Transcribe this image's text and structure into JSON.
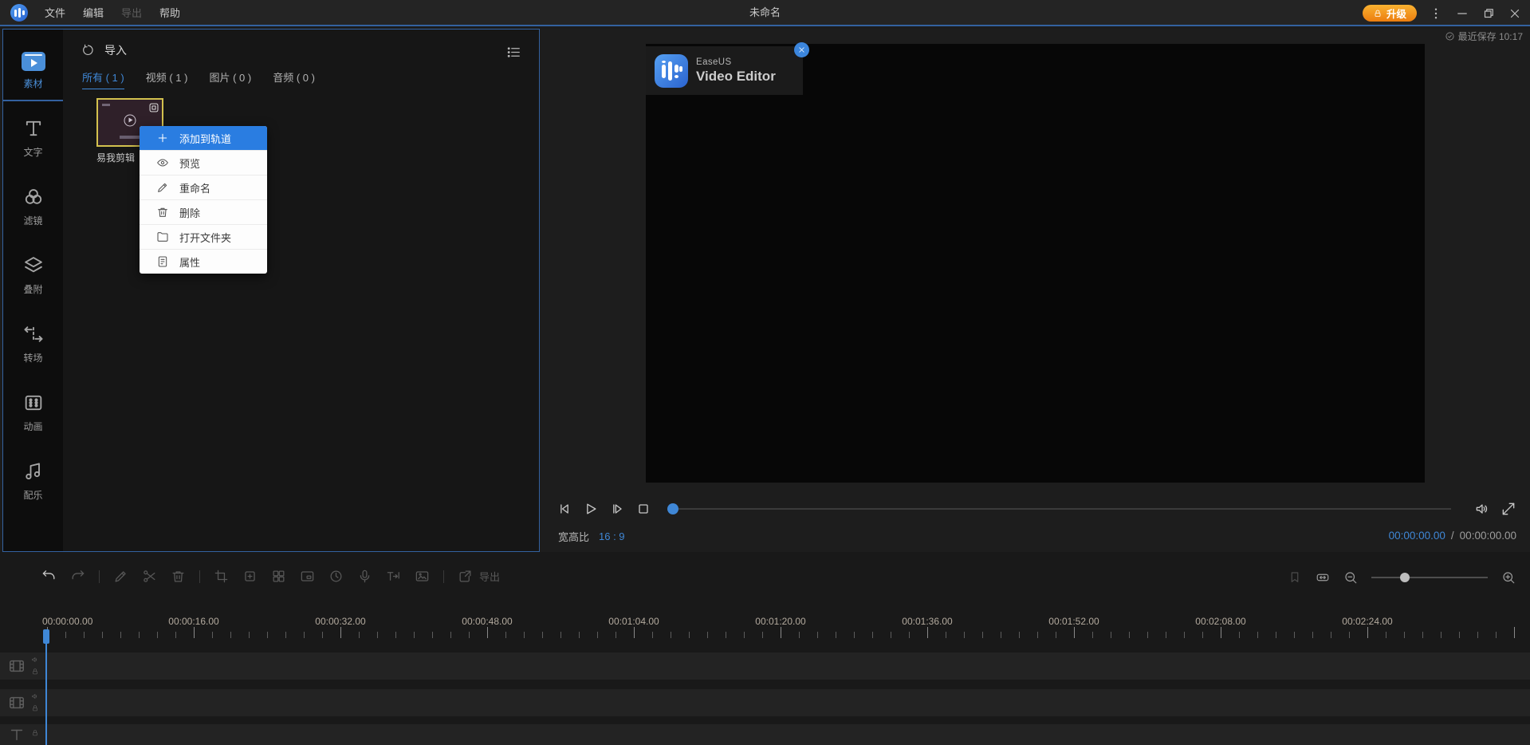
{
  "colors": {
    "accent": "#3f87d6",
    "menu_highlight": "#2a7de1",
    "panel_border": "#33619f",
    "upgrade_orange": "#ec7d0f",
    "thumb_border": "#d3c14e"
  },
  "window": {
    "title": "未命名",
    "menus": [
      {
        "label": "文件",
        "disabled": false
      },
      {
        "label": "编辑",
        "disabled": false
      },
      {
        "label": "导出",
        "disabled": true
      },
      {
        "label": "帮助",
        "disabled": false
      }
    ],
    "upgrade_label": "升级",
    "saved_status": "最近保存 10:17"
  },
  "sidebar": {
    "items": [
      {
        "label": "素材",
        "icon": "material",
        "active": true
      },
      {
        "label": "文字",
        "icon": "text-tool",
        "active": false
      },
      {
        "label": "滤镜",
        "icon": "filter",
        "active": false
      },
      {
        "label": "叠附",
        "icon": "overlay",
        "active": false
      },
      {
        "label": "转场",
        "icon": "transition",
        "active": false
      },
      {
        "label": "动画",
        "icon": "animation",
        "active": false
      },
      {
        "label": "配乐",
        "icon": "music",
        "active": false
      }
    ]
  },
  "media": {
    "import_label": "导入",
    "tabs": [
      {
        "label": "所有 ( 1 )",
        "active": true
      },
      {
        "label": "视频 ( 1 )",
        "active": false
      },
      {
        "label": "图片 ( 0 )",
        "active": false
      },
      {
        "label": "音频 ( 0 )",
        "active": false
      }
    ],
    "clip_name": "易我剪辑"
  },
  "context_menu": {
    "items": [
      {
        "label": "添加到轨道",
        "icon": "plus",
        "highlight": true
      },
      {
        "label": "预览",
        "icon": "eye",
        "highlight": false
      },
      {
        "label": "重命名",
        "icon": "pencil",
        "highlight": false
      },
      {
        "label": "删除",
        "icon": "trash",
        "highlight": false
      },
      {
        "label": "打开文件夹",
        "icon": "folder",
        "highlight": false
      },
      {
        "label": "属性",
        "icon": "properties",
        "highlight": false
      }
    ]
  },
  "preview": {
    "brand_line1": "EaseUS",
    "brand_line2": "Video Editor",
    "aspect_label": "宽高比",
    "aspect_value": "16 : 9",
    "current_time": "00:00:00.00",
    "total_time": "00:00:00.00"
  },
  "timeline": {
    "toolbar_left": [
      "undo",
      "redo",
      "|",
      "pencil",
      "scissors",
      "trash",
      "|",
      "crop",
      "frame-plus",
      "grid",
      "pip",
      "clock",
      "mic",
      "tts",
      "mosaic",
      "|",
      "export"
    ],
    "toolbar_enabled": [
      "undo"
    ],
    "export_label": "导出",
    "toolbar_right": [
      "marker",
      "fit",
      "zoom-out",
      "slider",
      "zoom-in"
    ],
    "ruler_labels": [
      "00:00:00.00",
      "00:00:16.00",
      "00:00:32.00",
      "00:00:48.00",
      "00:01:04.00",
      "00:01:20.00",
      "00:01:36.00",
      "00:01:52.00",
      "00:02:08.00",
      "00:02:24.00"
    ],
    "tracks": [
      {
        "type": "video",
        "gutter": [
          "filmstrip",
          "speaker-sm",
          "lock"
        ]
      },
      {
        "type": "video",
        "gutter": [
          "filmstrip",
          "speaker-sm",
          "lock"
        ]
      },
      {
        "type": "text",
        "gutter": [
          "text-sm",
          "lock"
        ]
      }
    ]
  }
}
